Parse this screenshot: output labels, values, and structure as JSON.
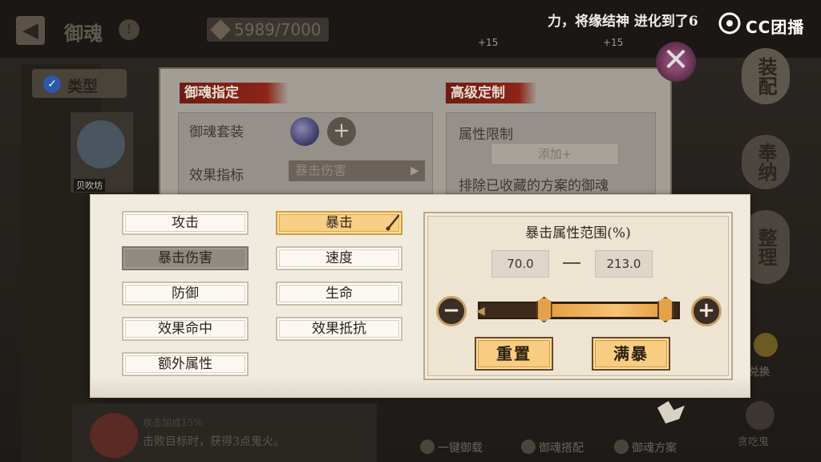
{
  "header": {
    "back_symbol": "◀",
    "title": "御魂",
    "help_symbol": "!",
    "soul_count": "5989/7000",
    "marquee": "力，将缘结神 进化到了6",
    "logo_text": "CC团播"
  },
  "right_sidebar": {
    "equip": "装配",
    "storage": "奉纳",
    "organize": "整理",
    "exchange": "兑换",
    "glutton": "贪吃鬼"
  },
  "left_sidebar": {
    "type_label": "类型",
    "card_label": "贝吹坊"
  },
  "bottom": {
    "desc_top": "攻击加成15%",
    "desc": "击败目标时，获得3点鬼火。",
    "actions": [
      "一键御载",
      "御魂搭配",
      "御魂方案"
    ]
  },
  "back_dialog": {
    "close_symbol": "✕",
    "plus_labels": [
      "+15",
      "+15"
    ],
    "left_banner": "御魂指定",
    "right_banner": "高级定制",
    "set_label": "御魂套装",
    "add_symbol": "+",
    "effect_label": "效果指标",
    "effect_value": "暴击伤害",
    "attr_limit_label": "属性限制",
    "add_button": "添加+",
    "exclude_label": "排除已收藏的方案的御魂"
  },
  "popup": {
    "attributes": {
      "attack": "攻击",
      "crit": "暴击",
      "crit_damage": "暴击伤害",
      "speed": "速度",
      "defense": "防御",
      "hp": "生命",
      "effect_hit": "效果命中",
      "effect_resist": "效果抵抗",
      "extra": "额外属性"
    },
    "selected_attribute": "暴击",
    "disabled_attribute": "暴击伤害",
    "range": {
      "title": "暴击属性范围(%)",
      "min": "70.0",
      "max": "213.0",
      "minus_symbol": "−",
      "plus_symbol": "+",
      "slider_low_fraction": 0.33,
      "slider_high_fraction": 1.0
    },
    "reset_button": "重置",
    "max_crit_button": "满暴"
  },
  "colors": {
    "selected": "#f8cf84",
    "disabled": "#8f8a82",
    "popup_bg": "#f0ebdf",
    "banner_red": "#8d2418"
  }
}
